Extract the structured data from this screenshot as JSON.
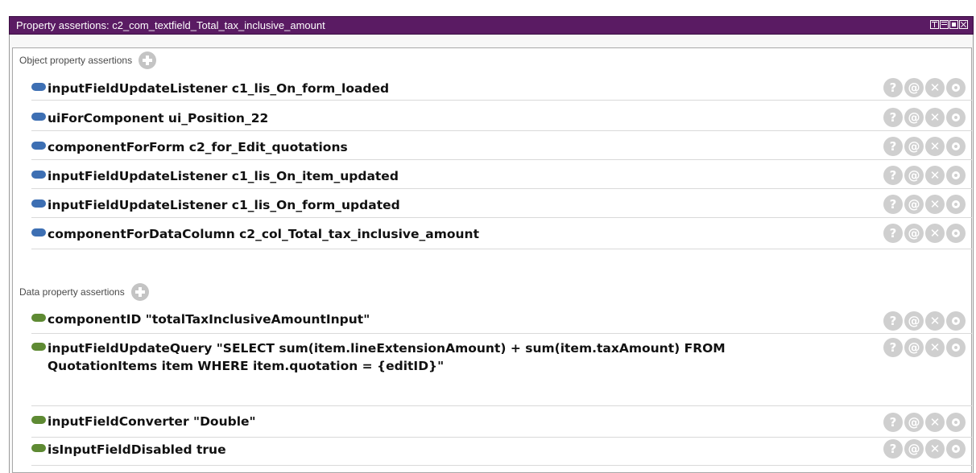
{
  "window": {
    "title": "Property assertions: c2_com_textfield_Total_tax_inclusive_amount"
  },
  "object_section": {
    "label": "Object property assertions",
    "rows": [
      {
        "text": "inputFieldUpdateListener  c1_lis_On_form_loaded"
      },
      {
        "text": "uiForComponent  ui_Position_22"
      },
      {
        "text": "componentForForm  c2_for_Edit_quotations"
      },
      {
        "text": "inputFieldUpdateListener  c1_lis_On_item_updated"
      },
      {
        "text": "inputFieldUpdateListener  c1_lis_On_form_updated"
      },
      {
        "text": "componentForDataColumn  c2_col_Total_tax_inclusive_amount"
      }
    ]
  },
  "data_section": {
    "label": "Data property assertions",
    "rows": [
      {
        "text": "componentID  \"totalTaxInclusiveAmountInput\""
      },
      {
        "text": "inputFieldUpdateQuery  \"SELECT sum(item.lineExtensionAmount) + sum(item.taxAmount) FROM QuotationItems item WHERE item.quotation = {editID}\""
      },
      {
        "text": "inputFieldConverter  \"Double\""
      },
      {
        "text": "isInputFieldDisabled  true"
      }
    ]
  },
  "actions": {
    "help": "?",
    "annotate": "@",
    "delete": "✕"
  },
  "colors": {
    "titlebar": "#5a1b63",
    "object_pill": "#3d6fb3",
    "data_pill": "#5e8a33",
    "action_button": "#cfcfcf"
  },
  "icons": {
    "add": "add-icon",
    "help": "help-icon",
    "annotate": "annotate-icon",
    "delete": "delete-icon",
    "edit": "edit-icon",
    "object_property": "object-property-icon",
    "data_property": "data-property-icon"
  }
}
